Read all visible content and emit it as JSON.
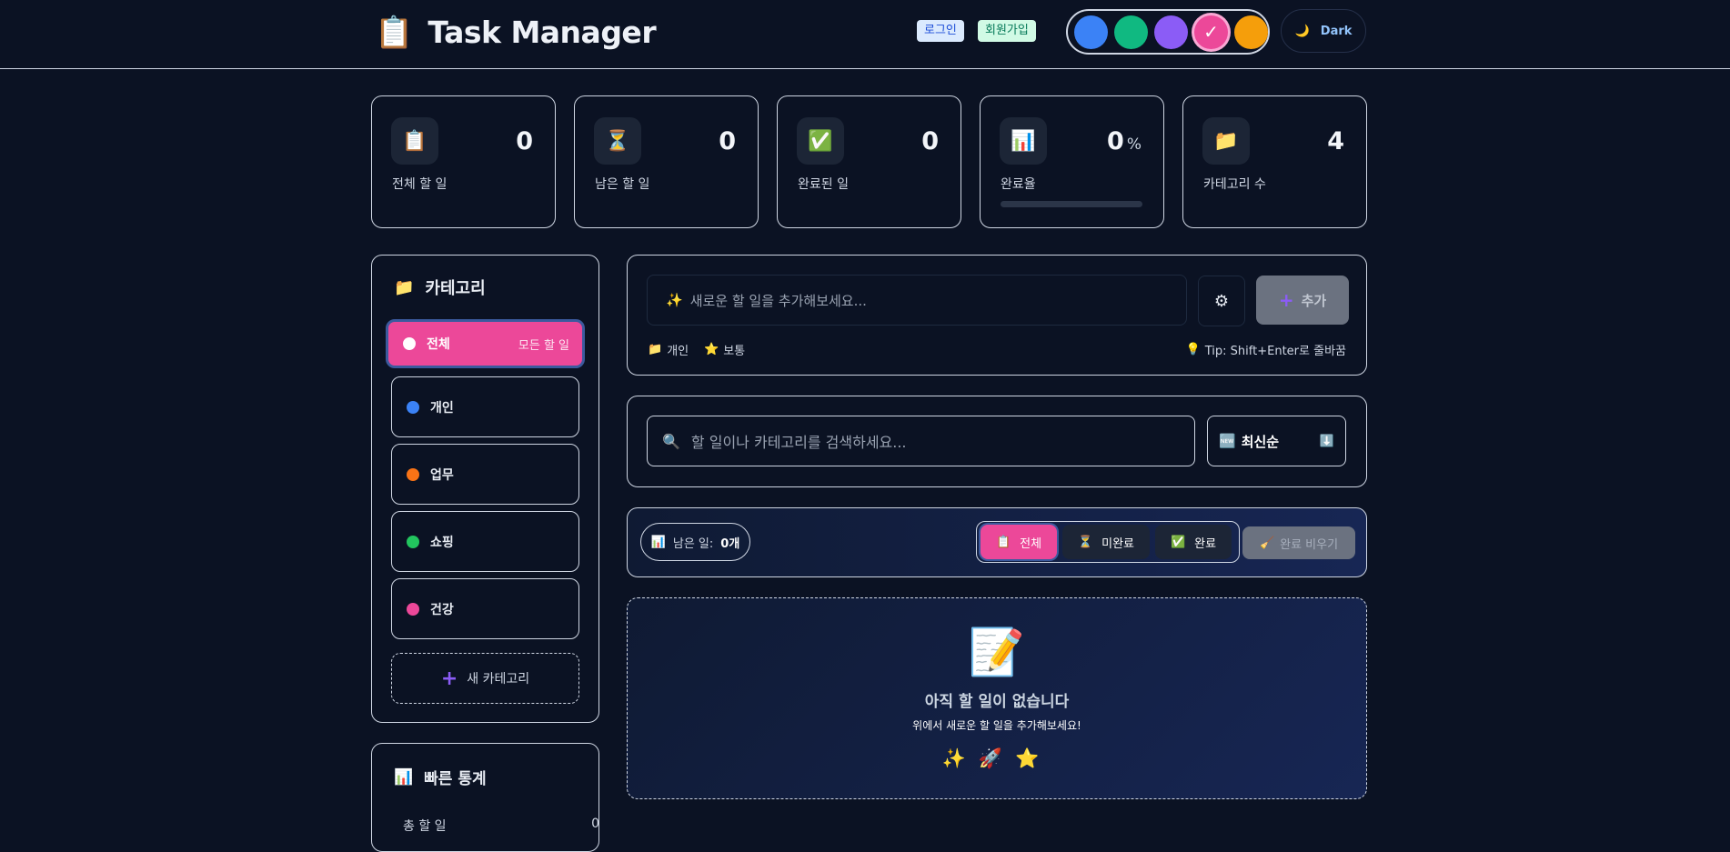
{
  "header": {
    "logo_icon": "📋",
    "title": "Task Manager",
    "login_label": "로그인",
    "signup_label": "회원가입",
    "theme_colors": [
      "#3b82f6",
      "#10b981",
      "#8b5cf6",
      "#ec4899",
      "#f59e0b"
    ],
    "selected_check": "✓",
    "mode_icon": "🌙",
    "mode_label": "Dark"
  },
  "stats": [
    {
      "icon": "📋",
      "value": "0",
      "unit": "",
      "label": "전체 할 일"
    },
    {
      "icon": "⏳",
      "value": "0",
      "unit": "",
      "label": "남은 할 일"
    },
    {
      "icon": "✅",
      "value": "0",
      "unit": "",
      "label": "완료된 일"
    },
    {
      "icon": "📊",
      "value": "0",
      "unit": "%",
      "label": "완료율",
      "progress": 0
    },
    {
      "icon": "📁",
      "value": "4",
      "unit": "",
      "label": "카테고리 수"
    }
  ],
  "categories": {
    "icon": "📁",
    "title": "카테고리",
    "active": {
      "label": "전체",
      "sub": "모든 할 일",
      "color": "#ffffff"
    },
    "items": [
      {
        "label": "개인",
        "color": "#3b82f6"
      },
      {
        "label": "업무",
        "color": "#f97316"
      },
      {
        "label": "쇼핑",
        "color": "#22c55e"
      },
      {
        "label": "건강",
        "color": "#ec4899"
      }
    ],
    "new_label": "새 카테고리"
  },
  "quick_stats": {
    "icon": "📊",
    "title": "빠른 통계",
    "rows": [
      {
        "label": "총 할 일",
        "value": "0"
      }
    ]
  },
  "add_task": {
    "placeholder_icon": "✨",
    "placeholder": "새로운 할 일을 추가해보세요...",
    "gear_icon": "⚙",
    "add_label": "추가",
    "category_icon": "📁",
    "category": "개인",
    "priority_icon": "⭐",
    "priority": "보통",
    "tip_icon": "💡",
    "tip": "Tip: Shift+Enter로 줄바꿈"
  },
  "search": {
    "icon": "🔍",
    "placeholder": "할 일이나 카테고리를 검색하세요...",
    "sort_icon": "🆕",
    "sort_label": "최신순",
    "sort_dir_icon": "⬇️"
  },
  "filters": {
    "remain_icon": "📊",
    "remain_label": "남은 일:",
    "remain_count": "0개",
    "options": [
      {
        "icon": "📋",
        "label": "전체",
        "active": true
      },
      {
        "icon": "⏳",
        "label": "미완료",
        "active": false
      },
      {
        "icon": "✅",
        "label": "완료",
        "active": false
      }
    ],
    "clear_icon": "🧹",
    "clear_label": "완료 비우기"
  },
  "empty_state": {
    "icon": "📝",
    "title": "아직 할 일이 없습니다",
    "subtitle": "위에서 새로운 할 일을 추가해보세요!",
    "emojis": "✨🚀⭐"
  }
}
